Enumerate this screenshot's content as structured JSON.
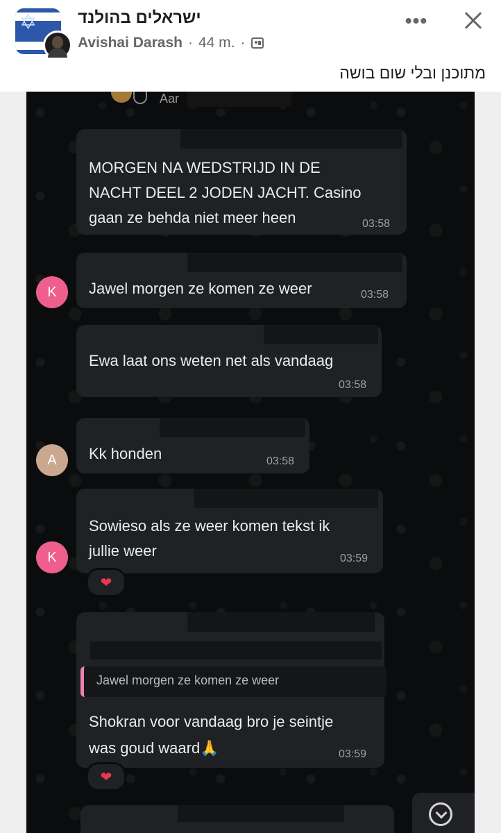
{
  "post": {
    "group_name": "ישראלים בהולנד",
    "author": "Avishai Darash",
    "time": "44 m.",
    "separator": "·",
    "text": "מתוכנן ובלי שום בושה"
  },
  "icons": {
    "more": "more-options-icon",
    "close": "close-icon",
    "audience": "group-audience-icon"
  },
  "chat": {
    "top_name": "Aar",
    "messages": [
      {
        "lines": [
          "MORGEN NA WEDSTRIJD IN DE",
          "NACHT DEEL 2 JODEN JACHT. Casino",
          "gaan ze behda niet meer heen"
        ],
        "time": "03:58"
      },
      {
        "avatar": "K",
        "lines": [
          "Jawel morgen ze komen ze weer"
        ],
        "time": "03:58"
      },
      {
        "lines": [
          "Ewa laat ons weten net als vandaag"
        ],
        "time": "03:58"
      },
      {
        "avatar": "A",
        "lines": [
          "Kk honden"
        ],
        "time": "03:58"
      },
      {
        "avatar": "K",
        "lines": [
          "Sowieso als ze weer komen tekst ik",
          "jullie weer"
        ],
        "time": "03:59",
        "reaction": "❤"
      },
      {
        "quote": "Jawel morgen ze komen ze weer",
        "lines": [
          "Shokran voor vandaag bro je seintje",
          "was goud waard🙏"
        ],
        "time": "03:59",
        "reaction": "❤"
      }
    ]
  },
  "colors": {
    "chat_background": "#0b0c0d",
    "bubble": "#1f2124",
    "avatar_k": "#ee5f8d",
    "avatar_a": "#c9a88f",
    "quote_accent": "#ef7fb0"
  }
}
